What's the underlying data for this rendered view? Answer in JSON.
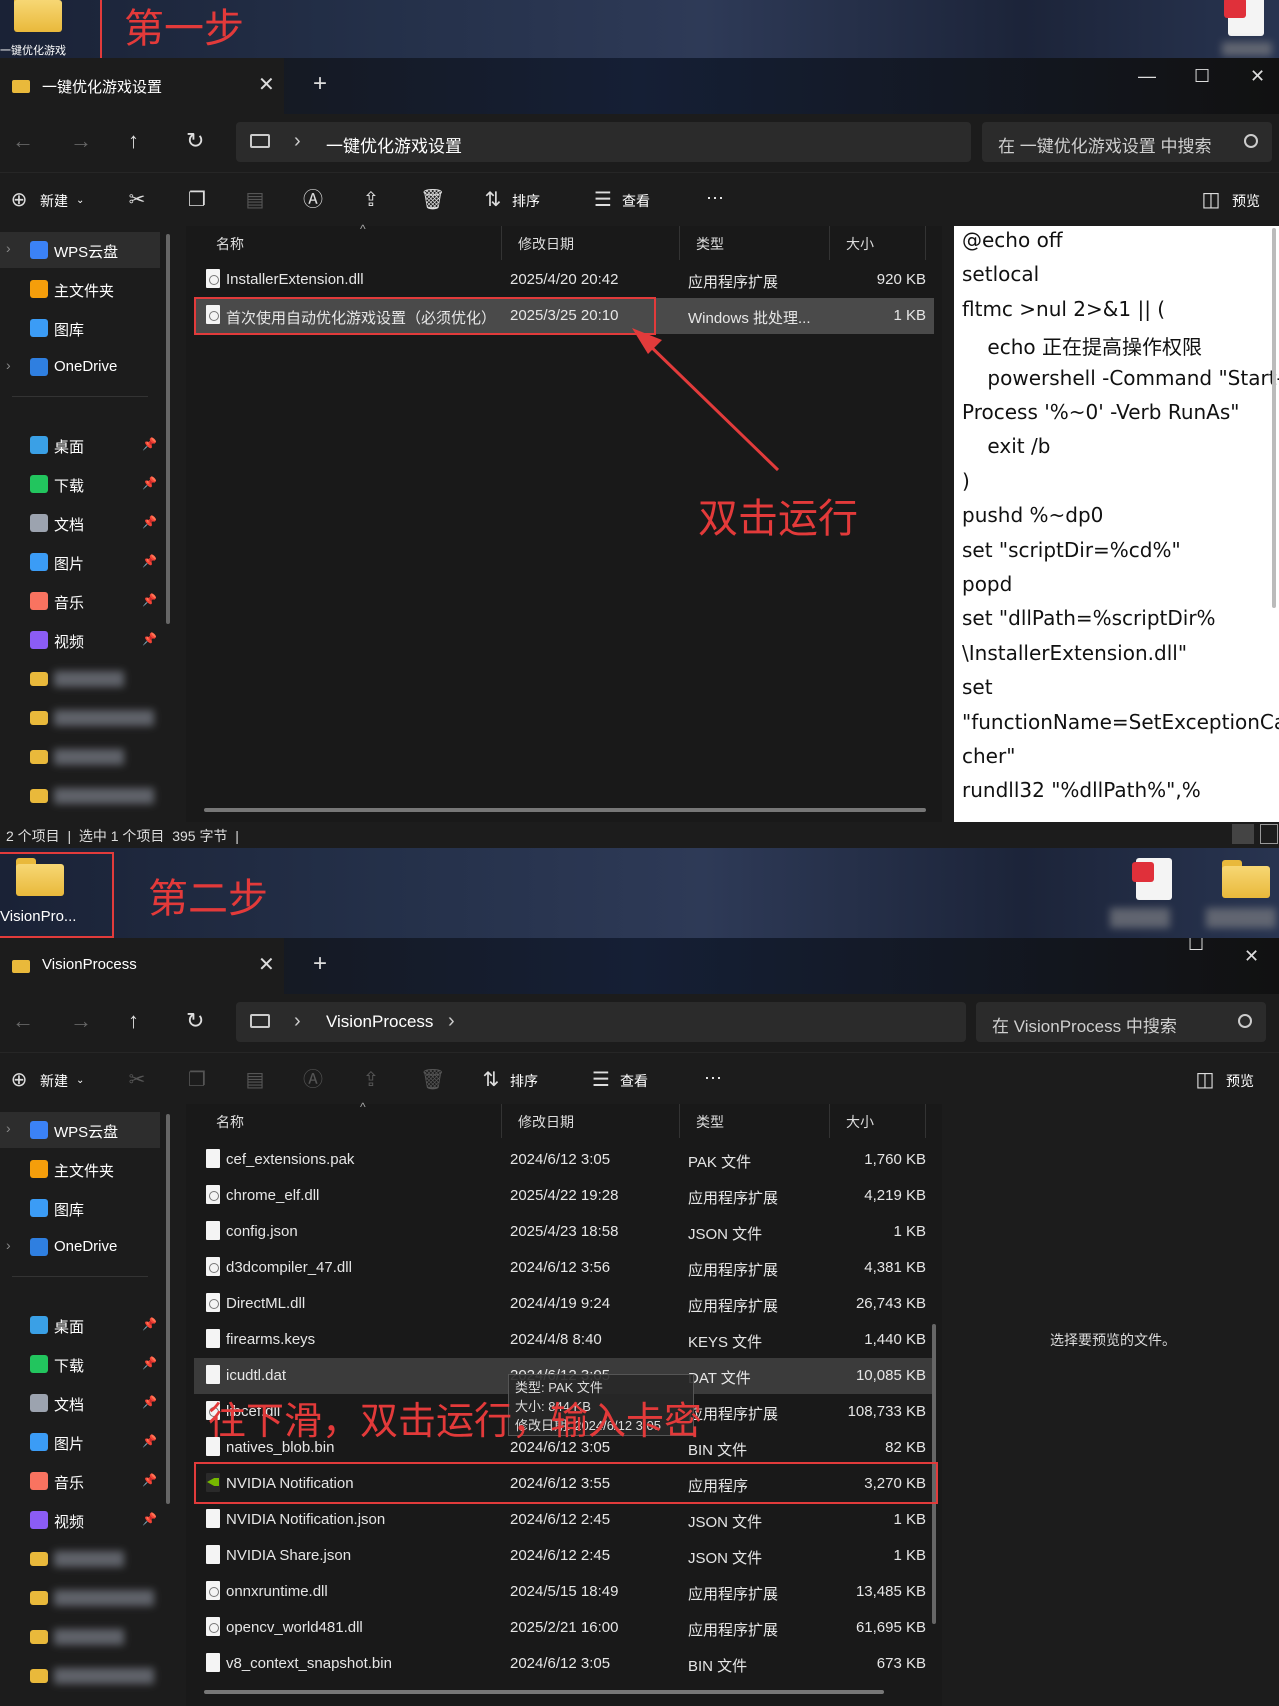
{
  "step1": {
    "desktop": {
      "folder_label": "一键优化游戏",
      "step_label": "第一步"
    },
    "window": {
      "tab_title": "一键优化游戏设置",
      "path": "一键优化游戏设置",
      "search_placeholder": "在 一键优化游戏设置 中搜索",
      "columns": [
        "名称",
        "修改日期",
        "类型",
        "大小"
      ],
      "files": [
        {
          "name": "InstallerExtension.dll",
          "date": "2025/4/20 20:42",
          "type": "应用程序扩展",
          "size": "920 KB"
        },
        {
          "name": "首次使用自动优化游戏设置（必须优化）",
          "date": "2025/3/25 20:10",
          "type": "Windows 批处理...",
          "size": "1 KB"
        }
      ],
      "status": "2 个项目  |  选中 1 个项目  395 字节  |",
      "annotation": "双击运行",
      "preview_lines": [
        "@echo off",
        "setlocal",
        "fltmc >nul 2>&1 || (",
        "    echo 正在提高操作权限",
        "    powershell -Command \"Start-",
        "Process '%~0' -Verb RunAs\"",
        "    exit /b",
        ")",
        "pushd %~dp0",
        "set \"scriptDir=%cd%\"",
        "popd",
        "set \"dllPath=%scriptDir%",
        "\\InstallerExtension.dll\"",
        "set",
        "\"functionName=SetExceptionCat",
        "cher\"",
        "rundll32 \"%dllPath%\",%"
      ]
    }
  },
  "step2": {
    "desktop": {
      "folder_label": "VisionPro...",
      "step_label": "第二步"
    },
    "window": {
      "tab_title": "VisionProcess",
      "path": "VisionProcess",
      "search_placeholder": "在 VisionProcess 中搜索",
      "columns": [
        "名称",
        "修改日期",
        "类型",
        "大小"
      ],
      "files": [
        {
          "name": "cef_extensions.pak",
          "date": "2024/6/12 3:05",
          "type": "PAK 文件",
          "size": "1,760 KB",
          "icon": "file"
        },
        {
          "name": "chrome_elf.dll",
          "date": "2025/4/22 19:28",
          "type": "应用程序扩展",
          "size": "4,219 KB",
          "icon": "dll"
        },
        {
          "name": "config.json",
          "date": "2025/4/23 18:58",
          "type": "JSON 文件",
          "size": "1 KB",
          "icon": "file"
        },
        {
          "name": "d3dcompiler_47.dll",
          "date": "2024/6/12 3:56",
          "type": "应用程序扩展",
          "size": "4,381 KB",
          "icon": "dll"
        },
        {
          "name": "DirectML.dll",
          "date": "2024/4/19 9:24",
          "type": "应用程序扩展",
          "size": "26,743 KB",
          "icon": "dll"
        },
        {
          "name": "firearms.keys",
          "date": "2024/4/8 8:40",
          "type": "KEYS 文件",
          "size": "1,440 KB",
          "icon": "file"
        },
        {
          "name": "icudtl.dat",
          "date": "2024/6/12 3:05",
          "type": "DAT 文件",
          "size": "10,085 KB",
          "icon": "file"
        },
        {
          "name": "libcef.dll",
          "date": "",
          "type": "应用程序扩展",
          "size": "108,733 KB",
          "icon": "dll"
        },
        {
          "name": "natives_blob.bin",
          "date": "2024/6/12 3:05",
          "type": "BIN 文件",
          "size": "82 KB",
          "icon": "file"
        },
        {
          "name": "NVIDIA Notification",
          "date": "2024/6/12 3:55",
          "type": "应用程序",
          "size": "3,270 KB",
          "icon": "exe"
        },
        {
          "name": "NVIDIA Notification.json",
          "date": "2024/6/12 2:45",
          "type": "JSON 文件",
          "size": "1 KB",
          "icon": "file"
        },
        {
          "name": "NVIDIA Share.json",
          "date": "2024/6/12 2:45",
          "type": "JSON 文件",
          "size": "1 KB",
          "icon": "file"
        },
        {
          "name": "onnxruntime.dll",
          "date": "2024/5/15 18:49",
          "type": "应用程序扩展",
          "size": "13,485 KB",
          "icon": "dll"
        },
        {
          "name": "opencv_world481.dll",
          "date": "2025/2/21 16:00",
          "type": "应用程序扩展",
          "size": "61,695 KB",
          "icon": "dll"
        },
        {
          "name": "v8_context_snapshot.bin",
          "date": "2024/6/12 3:05",
          "type": "BIN 文件",
          "size": "673 KB",
          "icon": "file"
        }
      ],
      "tooltip": [
        "类型: PAK 文件",
        "大小: 844 KB",
        "修改日期: 2024/6/12 3:05"
      ],
      "annotation": "往下滑，双击运行，输入卡密",
      "preview_placeholder": "选择要预览的文件。"
    }
  },
  "toolbar": {
    "new_label": "新建",
    "sort_label": "排序",
    "view_label": "查看",
    "more_label": "···",
    "preview_label": "预览"
  },
  "sidebar": {
    "top": [
      {
        "label": "WPS云盘",
        "color": "#3b82f6"
      },
      {
        "label": "主文件夹",
        "color": "#f59e0b"
      },
      {
        "label": "图库",
        "color": "#3b9cf6"
      },
      {
        "label": "OneDrive",
        "color": "#2f7fe0"
      }
    ],
    "quick": [
      {
        "label": "桌面",
        "color": "#3aa0e6"
      },
      {
        "label": "下载",
        "color": "#22c55e"
      },
      {
        "label": "文档",
        "color": "#9ca3af"
      },
      {
        "label": "图片",
        "color": "#3b9cf6"
      },
      {
        "label": "音乐",
        "color": "#f97360"
      },
      {
        "label": "视频",
        "color": "#8b5cf6"
      }
    ]
  },
  "colors": {
    "accent_red": "#e23b3b",
    "folder_yellow": "#e9b93b"
  }
}
